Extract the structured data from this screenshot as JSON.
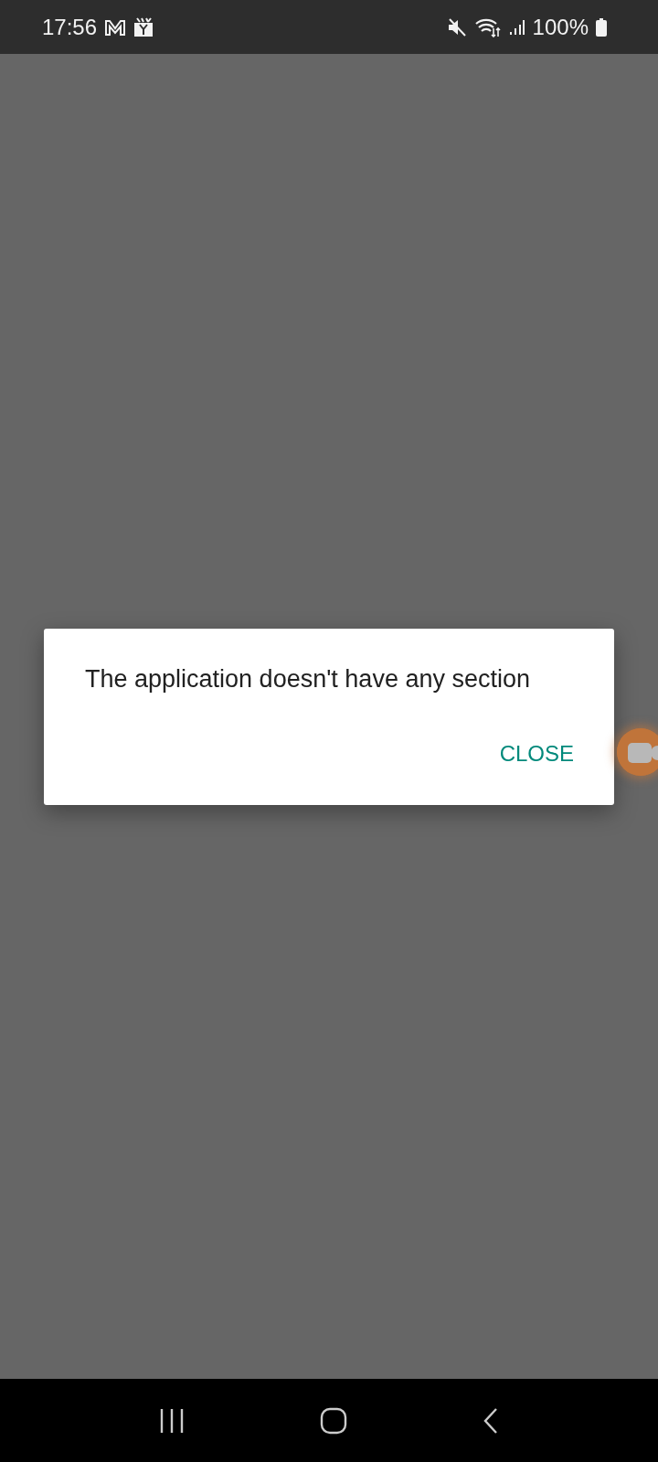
{
  "status_bar": {
    "time": "17:56",
    "battery": "100%"
  },
  "dialog": {
    "message": "The application doesn't have any section",
    "buttons": [
      "CLOSE"
    ]
  }
}
